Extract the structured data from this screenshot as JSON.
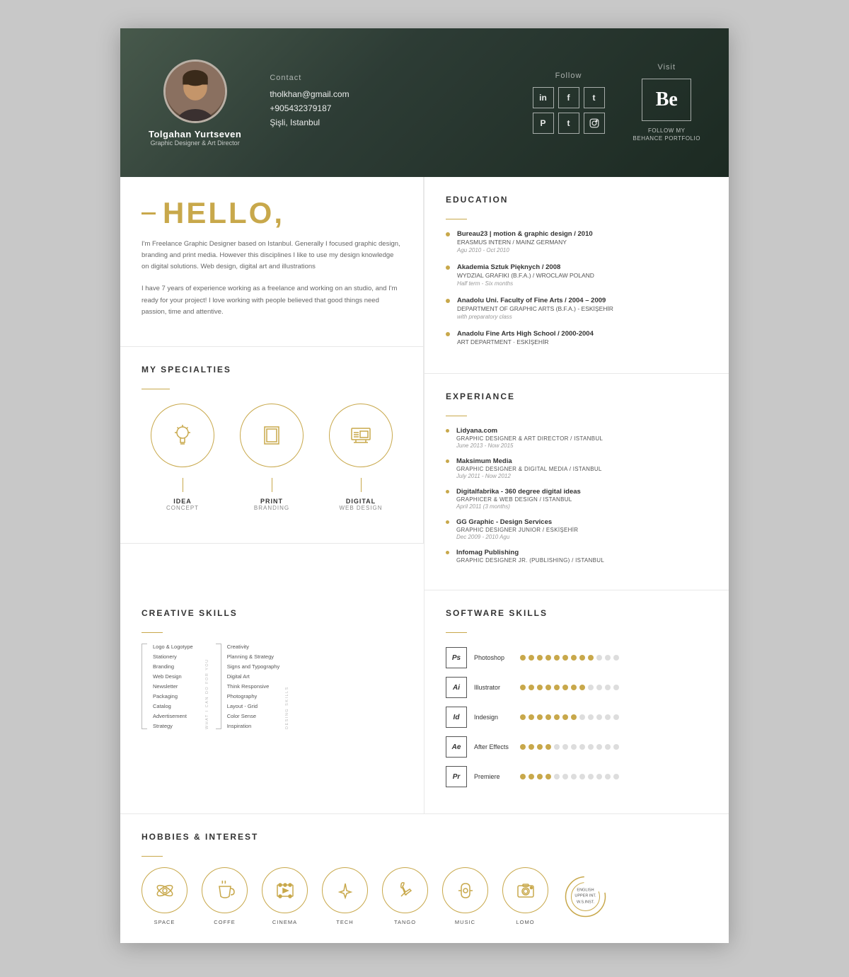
{
  "header": {
    "name": "Tolgahan Yurtseven",
    "title": "Graphic Designer & Art Director",
    "contact_label": "Contact",
    "email": "tholkhan@gmail.com",
    "phone": "+905432379187",
    "location": "Şişli, Istanbul",
    "follow_label": "Follow",
    "visit_label": "Visit",
    "behance_label": "FOLLOW MY\nBEHANCE PORTFOLIO",
    "social_icons": [
      "in",
      "f",
      "t",
      "P",
      "T",
      "📷"
    ]
  },
  "hello": {
    "title": "HELLO,",
    "para1": "I'm Freelance Graphic Designer based on Istanbul. Generally I focused graphic design, branding and print media. However this disciplines I like to use my design knowledge on digital solutions. Web design, digital art and illustrations",
    "para2": "I have 7 years of experience working as a freelance and working on an studio, and I'm ready for your project! I love working with people believed that good things need passion, time and attentive."
  },
  "specialties": {
    "title": "MY SPECIALTIES",
    "items": [
      {
        "label": "IDEA",
        "sublabel": "CONCEPT"
      },
      {
        "label": "PRINT",
        "sublabel": "BRANDING"
      },
      {
        "label": "DIGITAL",
        "sublabel": "WEB DESIGN"
      }
    ]
  },
  "education": {
    "title": "EDUCATION",
    "items": [
      {
        "title": "Bureau23 | motion & graphic design / 2010",
        "sub": "ERASMUS INTERN / MAINZ GERMANY",
        "date": "Agu 2010 - Oct 2010"
      },
      {
        "title": "Akademia Sztuk Pięknych / 2008",
        "sub": "WYDZIAL GRAFIKI (B.F.A.) / WROCLAW POLAND",
        "date": "Half term - Six months"
      },
      {
        "title": "Anadolu Uni. Faculty of Fine Arts / 2004 – 2009",
        "sub": "DEPARTMENT OF GRAPHIC ARTS (B.F.A.) - ESKİŞEHİR",
        "date": "with preparatory class"
      },
      {
        "title": "Anadolu Fine Arts High School / 2000-2004",
        "sub": "ART DEPARTMENT · ESKİŞEHİR",
        "date": ""
      }
    ]
  },
  "experience": {
    "title": "EXPERIANCE",
    "items": [
      {
        "title": "Lidyana.com",
        "sub": "GRAPHIC DESIGNER & ART DIRECTOR / ISTANBUL",
        "date": "June 2013 - Now 2015"
      },
      {
        "title": "Maksimum Media",
        "sub": "GRAPHIC DESIGNER & DIGITAL MEDIA / ISTANBUL",
        "date": "July 2011 - Now 2012"
      },
      {
        "title": "Digitalfabrika - 360 degree digital ideas",
        "sub": "GRAPHICER & WEB DESIGN / ISTANBUL",
        "date": "April 2011 (3 months)"
      },
      {
        "title": "GG Graphic - Design Services",
        "sub": "GRAPHIC DESIGNER JUNIOR / ESKİŞEHİR",
        "date": "Dec 2009 - 2010 Agu"
      },
      {
        "title": "Infomag Publishing",
        "sub": "GRAPHIC DESIGNER JR. (PUBLISHING) / ISTANBUL",
        "date": ""
      }
    ]
  },
  "creative_skills": {
    "title": "CREATIVE SKILLS",
    "what_label": "WHAT I CAN DO FOR YOU",
    "design_label": "DESING SKILLS",
    "col1": [
      "Logo & Logotype",
      "Stationery",
      "Branding",
      "Web Design",
      "Newsletter",
      "Packaging",
      "Catalog",
      "Advertisement",
      "Strategy"
    ],
    "col2": [
      "Creativity",
      "Planning & Strategy",
      "Signs and Typography",
      "Digital Art",
      "Think Responsive",
      "Photography",
      "Layout - Grid",
      "Color Sense",
      "Inspiration"
    ]
  },
  "software_skills": {
    "title": "SOFTWARE SKILLS",
    "items": [
      {
        "icon": "Ps",
        "name": "Photoshop",
        "filled": 9,
        "total": 12
      },
      {
        "icon": "Ai",
        "name": "Illustrator",
        "filled": 8,
        "total": 12
      },
      {
        "icon": "Id",
        "name": "Indesign",
        "filled": 7,
        "total": 12
      },
      {
        "icon": "Ae",
        "name": "After Effects",
        "filled": 4,
        "total": 12
      },
      {
        "icon": "Pr",
        "name": "Premiere",
        "filled": 4,
        "total": 12
      }
    ]
  },
  "hobbies": {
    "title": "HOBBIES & INTEREST",
    "items": [
      {
        "label": "SPACE",
        "icon": "🔭"
      },
      {
        "label": "COFFE",
        "icon": "☕"
      },
      {
        "label": "CINEMA",
        "icon": "🎬"
      },
      {
        "label": "TECH",
        "icon": "🚀"
      },
      {
        "label": "TANGO",
        "icon": "👠"
      },
      {
        "label": "MUSIC",
        "icon": "🎧"
      },
      {
        "label": "LOMO",
        "icon": "📷"
      }
    ],
    "language": {
      "lines": [
        "ENGLISH",
        "UPPER INT.",
        "W.S.INST."
      ]
    }
  }
}
